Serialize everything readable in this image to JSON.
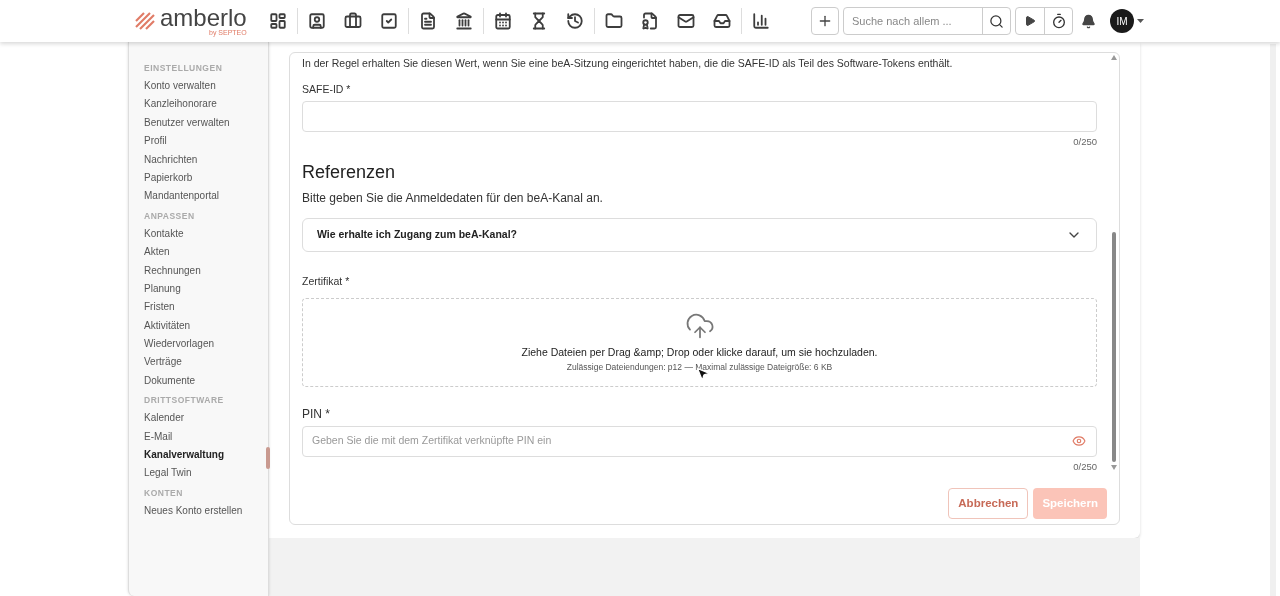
{
  "navbar": {
    "logo": {
      "name": "amberlo",
      "byline": "by SEPTEO"
    },
    "search": {
      "placeholder": "Suche nach allem ..."
    },
    "avatar": {
      "initials": "IM"
    }
  },
  "sidebar": {
    "sections": [
      {
        "title": "EINSTELLUNGEN",
        "items": [
          {
            "label": "Konto verwalten",
            "selected": false
          },
          {
            "label": "Kanzleihonorare",
            "selected": false
          },
          {
            "label": "Benutzer verwalten",
            "selected": false
          },
          {
            "label": "Profil",
            "selected": false
          },
          {
            "label": "Nachrichten",
            "selected": false
          },
          {
            "label": "Papierkorb",
            "selected": false
          },
          {
            "label": "Mandantenportal",
            "selected": false
          }
        ]
      },
      {
        "title": "ANPASSEN",
        "items": [
          {
            "label": "Kontakte",
            "selected": false
          },
          {
            "label": "Akten",
            "selected": false
          },
          {
            "label": "Rechnungen",
            "selected": false
          },
          {
            "label": "Planung",
            "selected": false
          },
          {
            "label": "Fristen",
            "selected": false
          },
          {
            "label": "Aktivitäten",
            "selected": false
          },
          {
            "label": "Wiedervorlagen",
            "selected": false
          },
          {
            "label": "Verträge",
            "selected": false
          },
          {
            "label": "Dokumente",
            "selected": false
          }
        ]
      },
      {
        "title": "DRITTSOFTWARE",
        "items": [
          {
            "label": "Kalender",
            "selected": false
          },
          {
            "label": "E-Mail",
            "selected": false
          },
          {
            "label": "Kanalverwaltung",
            "selected": true
          },
          {
            "label": "Legal Twin",
            "selected": false
          }
        ]
      },
      {
        "title": "KONTEN",
        "items": [
          {
            "label": "Neues Konto erstellen",
            "selected": false
          }
        ]
      }
    ]
  },
  "form": {
    "intro": "In der Regel erhalten Sie diesen Wert, wenn Sie eine beA-Sitzung eingerichtet haben, die die SAFE-ID als Teil des Software-Tokens enthält.",
    "safe_id": {
      "label": "SAFE-ID *",
      "counter": "0/250"
    },
    "section": {
      "title": "Referenzen",
      "subtitle": "Bitte geben Sie die Anmeldedaten für den beA-Kanal an."
    },
    "accordion": {
      "title": "Wie erhalte ich Zugang zum beA-Kanal?",
      "expanded": false
    },
    "certificate": {
      "label": "Zertifikat *",
      "drop_text": "Ziehe Dateien per Drag &amp; Drop oder klicke darauf, um sie hochzuladen.",
      "hint": "Zulässige Dateiendungen: p12 — Maximal zulässige Dateigröße: 6 KB"
    },
    "pin": {
      "label": "PIN *",
      "placeholder": "Geben Sie die mit dem Zertifikat verknüpfte PIN ein",
      "counter": "0/250"
    },
    "buttons": [
      {
        "label": "Abbrechen",
        "kind": "secondary",
        "disabled": false
      },
      {
        "label": "Speichern",
        "kind": "primary",
        "disabled": true
      }
    ]
  }
}
